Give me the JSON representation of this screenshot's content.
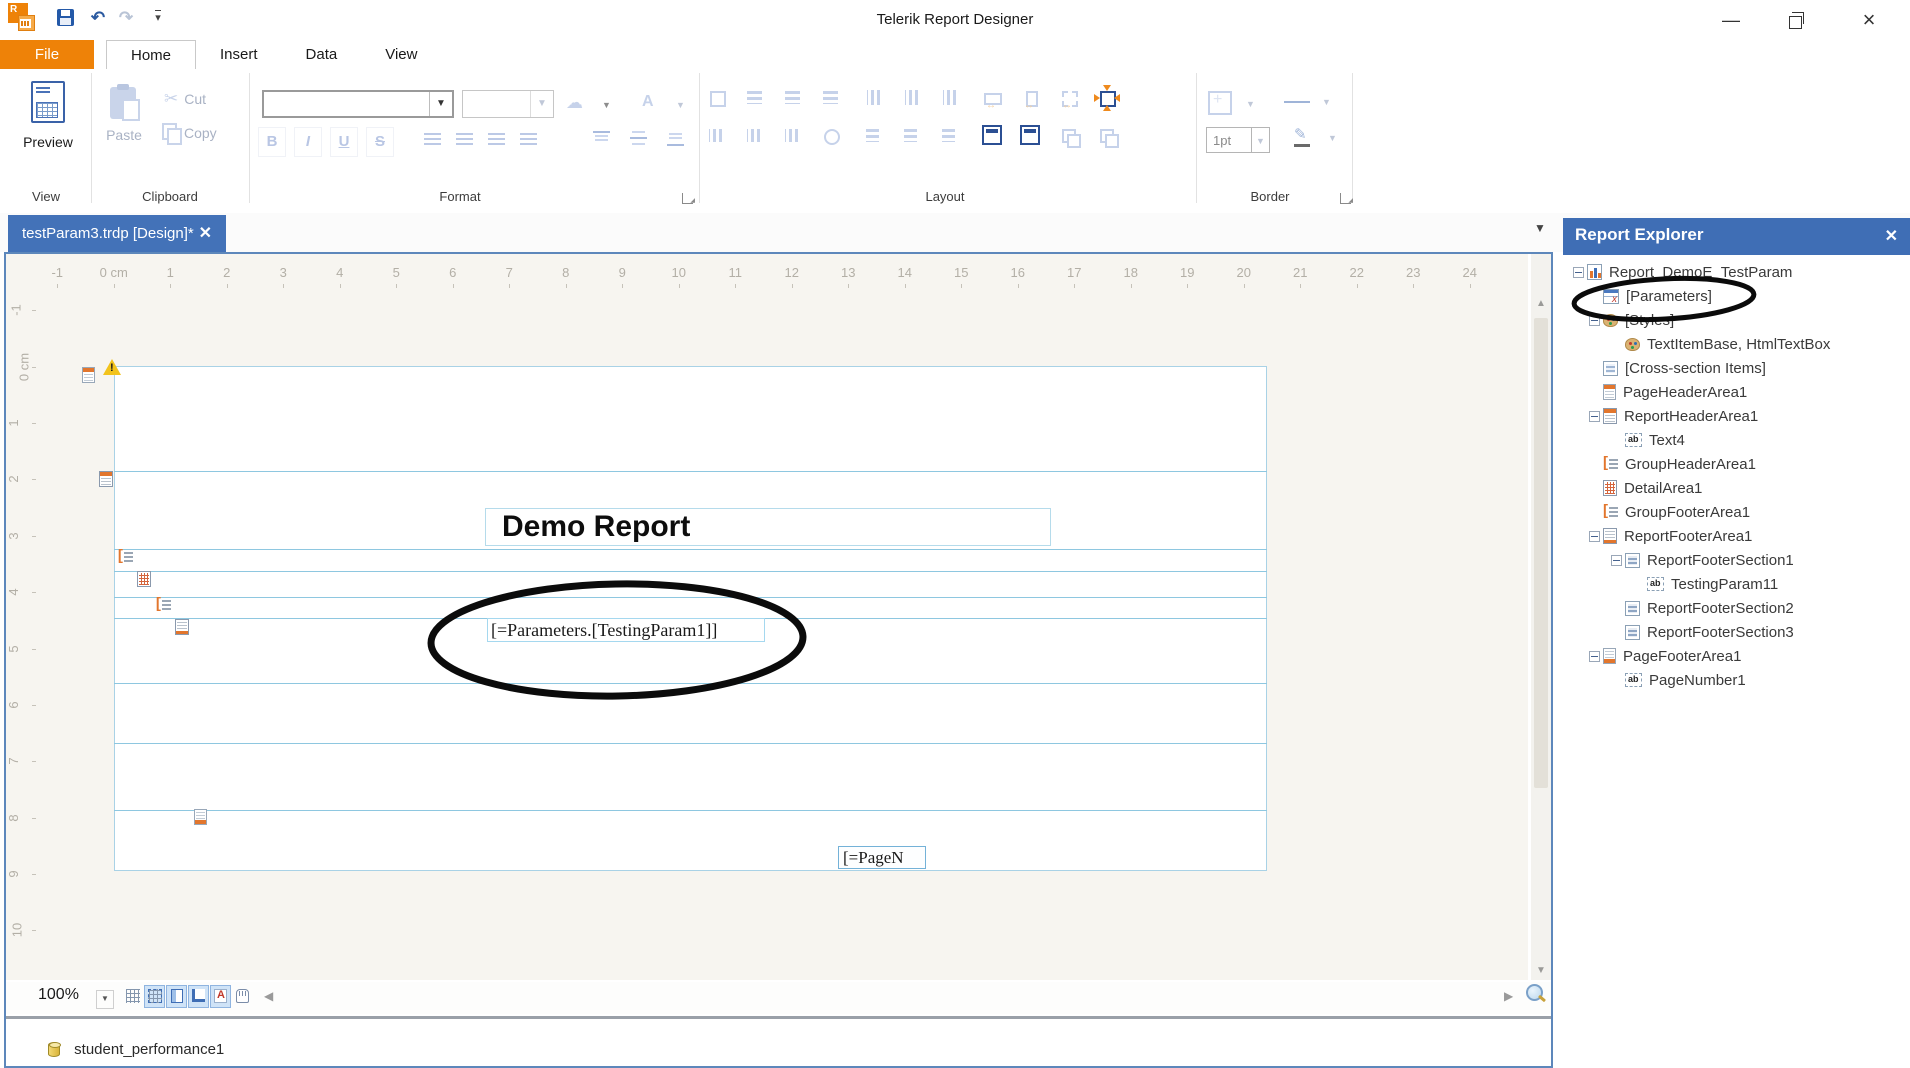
{
  "titlebar": {
    "title": "Telerik Report Designer"
  },
  "ribbon": {
    "tabs": [
      {
        "label": "File",
        "style": "file"
      },
      {
        "label": "Home",
        "style": "active"
      },
      {
        "label": "Insert"
      },
      {
        "label": "Data"
      },
      {
        "label": "View"
      }
    ],
    "groups": {
      "view": "View",
      "clipboard": "Clipboard",
      "format": "Format",
      "layout": "Layout",
      "border": "Border"
    },
    "buttons": {
      "preview": "Preview",
      "paste": "Paste",
      "cut": "Cut",
      "copy": "Copy"
    },
    "format_letters": {
      "bold": "B",
      "italic": "I",
      "underline": "U",
      "strike": "S"
    },
    "border_group": {
      "width_value": "1pt"
    }
  },
  "doctab": {
    "label": "testParam3.trdp [Design]*"
  },
  "ruler": {
    "h": [
      "-1",
      "0 cm",
      "1",
      "2",
      "3",
      "4",
      "5",
      "6",
      "7",
      "8",
      "9",
      "10",
      "11",
      "12",
      "13",
      "14",
      "15",
      "16",
      "17",
      "18",
      "19",
      "20",
      "21",
      "22",
      "23",
      "24"
    ],
    "v": [
      "-1",
      "0 cm",
      "1",
      "2",
      "3",
      "4",
      "5",
      "6",
      "7",
      "8",
      "9",
      "10"
    ]
  },
  "canvas": {
    "title_text": "Demo Report",
    "param_text": "[=Parameters.[TestingParam1]]",
    "pagenum_text": "[=PageN"
  },
  "explorer": {
    "title": "Report Explorer",
    "tree": [
      {
        "label": "Report_DemoE_TestParam",
        "lvl": "0",
        "icon": "report-icon",
        "exp": "minus"
      },
      {
        "label": "[Parameters]",
        "lvl": "1",
        "icon": "parameters-icon",
        "exp": ""
      },
      {
        "label": "[Styles]",
        "lvl": "1",
        "icon": "styles-icon",
        "exp": "minus"
      },
      {
        "label": "TextItemBase, HtmlTextBox",
        "lvl": "2",
        "icon": "styles-icon",
        "exp": ""
      },
      {
        "label": "[Cross-section Items]",
        "lvl": "1",
        "icon": "list-icon",
        "exp": ""
      },
      {
        "label": "PageHeaderArea1",
        "lvl": "1",
        "icon": "page-header-icon",
        "exp": ""
      },
      {
        "label": "ReportHeaderArea1",
        "lvl": "1",
        "icon": "table-header-icon",
        "exp": "minus"
      },
      {
        "label": "Text4",
        "lvl": "2",
        "icon": "textbox-icon",
        "exp": ""
      },
      {
        "label": "GroupHeaderArea1",
        "lvl": "1",
        "icon": "group-icon",
        "exp": ""
      },
      {
        "label": "DetailArea1",
        "lvl": "1",
        "icon": "detail-icon",
        "exp": ""
      },
      {
        "label": "GroupFooterArea1",
        "lvl": "1",
        "icon": "group-icon",
        "exp": ""
      },
      {
        "label": "ReportFooterArea1",
        "lvl": "1",
        "icon": "table-footer-icon",
        "exp": "minus"
      },
      {
        "label": "ReportFooterSection1",
        "lvl": "2",
        "icon": "section-icon",
        "exp": "minus"
      },
      {
        "label": "TestingParam11",
        "lvl": "3",
        "icon": "textbox-icon",
        "exp": ""
      },
      {
        "label": "ReportFooterSection2",
        "lvl": "2",
        "icon": "section-icon",
        "exp": ""
      },
      {
        "label": "ReportFooterSection3",
        "lvl": "2",
        "icon": "section-icon",
        "exp": ""
      },
      {
        "label": "PageFooterArea1",
        "lvl": "1",
        "icon": "page-footer-icon",
        "exp": "minus"
      },
      {
        "label": "PageNumber1",
        "lvl": "2",
        "icon": "textbox-icon",
        "exp": ""
      }
    ]
  },
  "statusbar": {
    "zoom": "100%",
    "toggles": [
      {
        "icon": "grid-toggle-icon",
        "on": "false"
      },
      {
        "icon": "snap-toggle-icon",
        "on": "true"
      },
      {
        "icon": "page-toggle-icon",
        "on": "true"
      },
      {
        "icon": "ruler-toggle-icon",
        "on": "true"
      },
      {
        "icon": "font-toggle-icon",
        "on": "true"
      },
      {
        "icon": "pan-toggle-icon",
        "on": "false"
      }
    ]
  },
  "datasources": {
    "items": [
      {
        "label": "student_performance1",
        "icon": "database-icon"
      }
    ]
  }
}
